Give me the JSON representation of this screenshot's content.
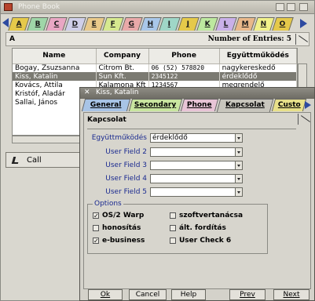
{
  "phonebook": {
    "title": "Phone Book",
    "letters": [
      "A",
      "B",
      "C",
      "D",
      "E",
      "F",
      "G",
      "H",
      "I",
      "J",
      "K",
      "L",
      "M",
      "N",
      "O"
    ],
    "letter_colors": [
      "#e5c94a",
      "#9fd6a8",
      "#e9a7c4",
      "#cfcfe9",
      "#e9c98a",
      "#d6e98f",
      "#e9a9a9",
      "#a9c7e9",
      "#9fd6c7",
      "#e5c94a",
      "#bde99f",
      "#c9b0e9",
      "#e9b88a",
      "#f1f18a",
      "#e5c94a"
    ],
    "current_letter": "A",
    "entries_label": "Number of Entries: 5",
    "columns": [
      "Name",
      "Company",
      "Phone",
      "Együttműködés"
    ],
    "rows": [
      {
        "name": "Bogay, Zsuzsanna",
        "company": "Citrom Bt.",
        "phone": "06 (52) 578820",
        "status": "nagykereskedő"
      },
      {
        "name": "Kiss, Katalin",
        "company": "Sun Kft.",
        "phone": "2345122",
        "status": "érdeklődő"
      },
      {
        "name": "Kovács, Attila",
        "company": "Kalamona Kft",
        "phone": "1234567",
        "status": "megrendelő"
      },
      {
        "name": "Kristóf, Aladár",
        "company": "",
        "phone": "",
        "status": ""
      },
      {
        "name": "Sallai, János",
        "company": "",
        "phone": "",
        "status": ""
      }
    ],
    "call_label": "Call"
  },
  "dialog": {
    "title": "Kiss, Katalin",
    "tabs": [
      "General",
      "Secondary",
      "Phone",
      "Kapcsolat",
      "Custo"
    ],
    "tab_colors": [
      "#a8c4e6",
      "#c9e6a0",
      "#e8c4d6",
      "#c8c6bd",
      "#e8e08a"
    ],
    "active_tab": "Kapcsolat",
    "section_title": "Kapcsolat",
    "fields": [
      {
        "label": "Együttműködés",
        "value": "érdeklődő"
      },
      {
        "label": "User Field 2",
        "value": ""
      },
      {
        "label": "User Field 3",
        "value": ""
      },
      {
        "label": "User Field 4",
        "value": ""
      },
      {
        "label": "User Field 5",
        "value": ""
      }
    ],
    "options_legend": "Options",
    "options": [
      {
        "label": "OS/2 Warp",
        "checked": true
      },
      {
        "label": "szoftvertanácsa",
        "checked": false
      },
      {
        "label": "honosítás",
        "checked": false
      },
      {
        "label": "ált. fordítás",
        "checked": false
      },
      {
        "label": "e-business",
        "checked": true
      },
      {
        "label": "User Check 6",
        "checked": false
      }
    ],
    "buttons": {
      "ok": "Ok",
      "cancel": "Cancel",
      "help": "Help",
      "prev": "Prev",
      "next": "Next"
    }
  }
}
